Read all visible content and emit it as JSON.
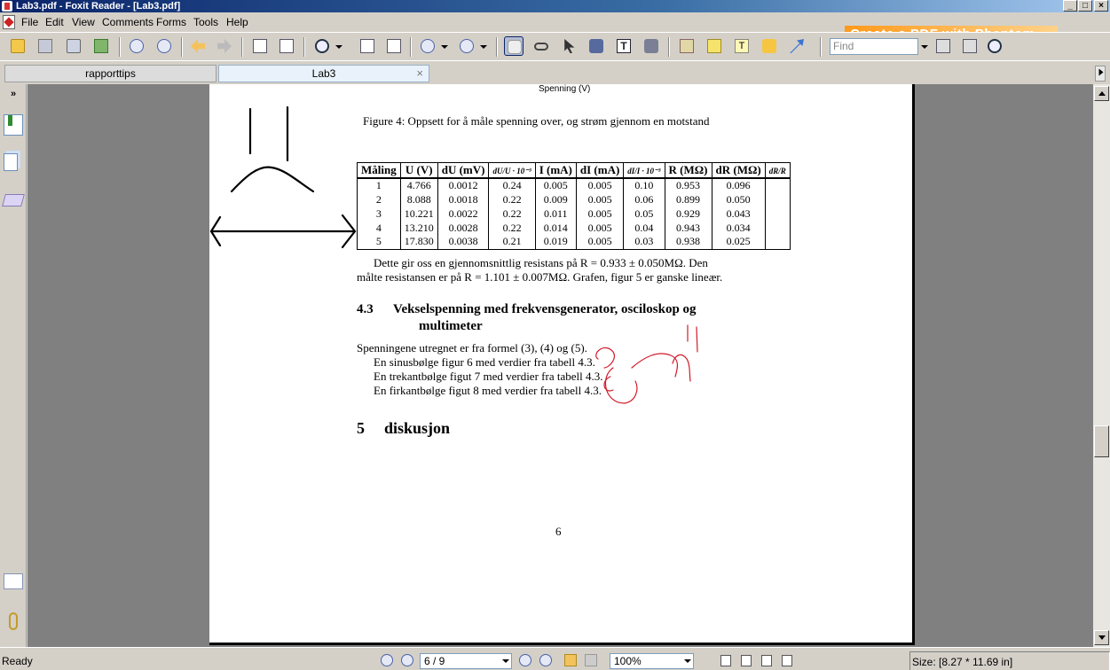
{
  "window": {
    "title": "Lab3.pdf - Foxit Reader - [Lab3.pdf]",
    "min_label": "_",
    "max_label": "□",
    "close_label": "×"
  },
  "menu": {
    "items": [
      "File",
      "Edit",
      "View",
      "Comments",
      "Forms",
      "Tools",
      "Help"
    ],
    "banner": "Create a PDF with Phantom"
  },
  "toolbar": {
    "find_placeholder": "Find",
    "text_tool_glyph": "T"
  },
  "tabs": [
    {
      "label": "rapporttips",
      "active": false
    },
    {
      "label": "Lab3",
      "active": true
    }
  ],
  "tab_close": "×",
  "document": {
    "running_head": "Spenning (V)",
    "figure_caption": "Figure 4:  Oppsett for å måle spenning over, og strøm gjennom en motstand",
    "table": {
      "headers": [
        "Måling",
        "U (V)",
        "dU (mV)",
        "dU/U · 10⁻³",
        "I (mA)",
        "dI (mA)",
        "dI/I · 10⁻³",
        "R (MΩ)",
        "dR (MΩ)",
        "dR/R"
      ],
      "rows": [
        [
          "1",
          "4.766",
          "0.0012",
          "0.24",
          "0.005",
          "0.005",
          "0.10",
          "0.953",
          "0.096",
          ""
        ],
        [
          "2",
          "8.088",
          "0.0018",
          "0.22",
          "0.009",
          "0.005",
          "0.06",
          "0.899",
          "0.050",
          ""
        ],
        [
          "3",
          "10.221",
          "0.0022",
          "0.22",
          "0.011",
          "0.005",
          "0.05",
          "0.929",
          "0.043",
          ""
        ],
        [
          "4",
          "13.210",
          "0.0028",
          "0.22",
          "0.014",
          "0.005",
          "0.04",
          "0.943",
          "0.034",
          ""
        ],
        [
          "5",
          "17.830",
          "0.0038",
          "0.21",
          "0.019",
          "0.005",
          "0.03",
          "0.938",
          "0.025",
          ""
        ]
      ]
    },
    "paragraph_line1": "Dette gir oss en gjennomsnittlig resistans på R = 0.933 ± 0.050MΩ.  Den",
    "paragraph_line2": "målte resistansen er på R = 1.101 ± 0.007MΩ.  Grafen, figur 5 er ganske lineær.",
    "section43_number": "4.3",
    "section43_title_a": "Vekselspenning med frekvensgenerator, osciloskop og",
    "section43_title_b": "multimeter",
    "body_line1": "Spenningene utregnet er fra formel (3), (4) og (5).",
    "body_line2": "En sinusbølge figur 6 med verdier fra tabell 4.3.",
    "body_line3": "En trekantbølge figut 7 med verdier fra tabell 4.3.",
    "body_line4": "En firkantbølge figut 8 med verdier fra tabell 4.3.",
    "section5_number": "5",
    "section5_title": "diskusjon",
    "page_number": "6"
  },
  "statusbar": {
    "ready": "Ready",
    "page_display": "6 / 9",
    "zoom": "100%",
    "size": "Size: [8.27 * 11.69 in]"
  },
  "colors": {
    "titlebar": "#0a246a",
    "annotation_ink": "#d11a2a",
    "banner": "#ff9a1a"
  }
}
